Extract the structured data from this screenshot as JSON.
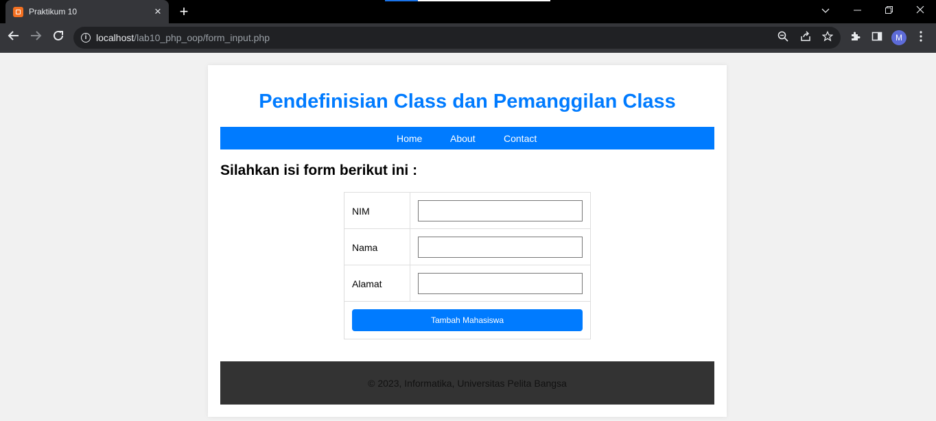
{
  "browser": {
    "tab_title": "Praktikum 10",
    "tab_close": "×",
    "new_tab": "+",
    "url_host": "localhost",
    "url_path": "/lab10_php_oop/form_input.php",
    "avatar_letter": "M",
    "icons": [
      "xampp-favicon",
      "back-icon",
      "forward-icon",
      "reload-icon",
      "info-icon",
      "zoom-icon",
      "share-icon",
      "bookmark-star-icon",
      "extensions-icon",
      "side-panel-icon",
      "menu-icon",
      "chevron-down-icon",
      "minimize-icon",
      "restore-icon",
      "close-window-icon"
    ]
  },
  "page": {
    "title": "Pendefinisian Class dan Pemanggilan Class",
    "nav": {
      "home": "Home",
      "about": "About",
      "contact": "Contact"
    },
    "form_heading": "Silahkan isi form berikut ini :",
    "form": {
      "fields": [
        {
          "label": "NIM",
          "value": ""
        },
        {
          "label": "Nama",
          "value": ""
        },
        {
          "label": "Alamat",
          "value": ""
        }
      ],
      "submit_label": "Tambah Mahasiswa"
    },
    "footer": "© 2023, Informatika, Universitas Pelita Bangsa"
  },
  "colors": {
    "accent": "#007bff",
    "footer_bg": "#333333",
    "page_bg": "#f1f1f1",
    "browser_dark": "#35363a"
  }
}
